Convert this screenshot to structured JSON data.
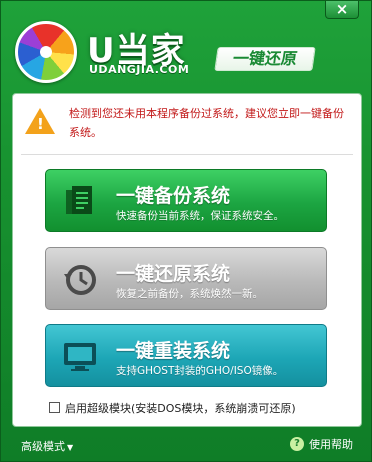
{
  "window": {
    "close_label": "×",
    "brand": "U当家",
    "brand_sub": "UDANGJIA.COM",
    "badge": "一键还原"
  },
  "warning": {
    "icon": "warning-icon",
    "text": "检测到您还未用本程序备份过系统，建议您立即一键备份系统。"
  },
  "actions": [
    {
      "title": "一键备份系统",
      "desc": "快速备份当前系统，保证系统安全。",
      "icon": "backup-document-icon",
      "color": "#1ca542"
    },
    {
      "title": "一键还原系统",
      "desc": "恢复之前备份，系统焕然一新。",
      "icon": "history-clock-icon",
      "color": "#b9b9b9"
    },
    {
      "title": "一键重装系统",
      "desc": "支持GHOST封装的GHO/ISO镜像。",
      "icon": "monitor-icon",
      "color": "#1da6b6"
    }
  ],
  "advanced": {
    "checkbox_label": "启用超级模块(安装DOS模块，系统崩溃可还原)",
    "checked": false
  },
  "footer": {
    "mode_label": "高级模式",
    "help_label": "使用帮助",
    "help_icon": "question-icon"
  }
}
